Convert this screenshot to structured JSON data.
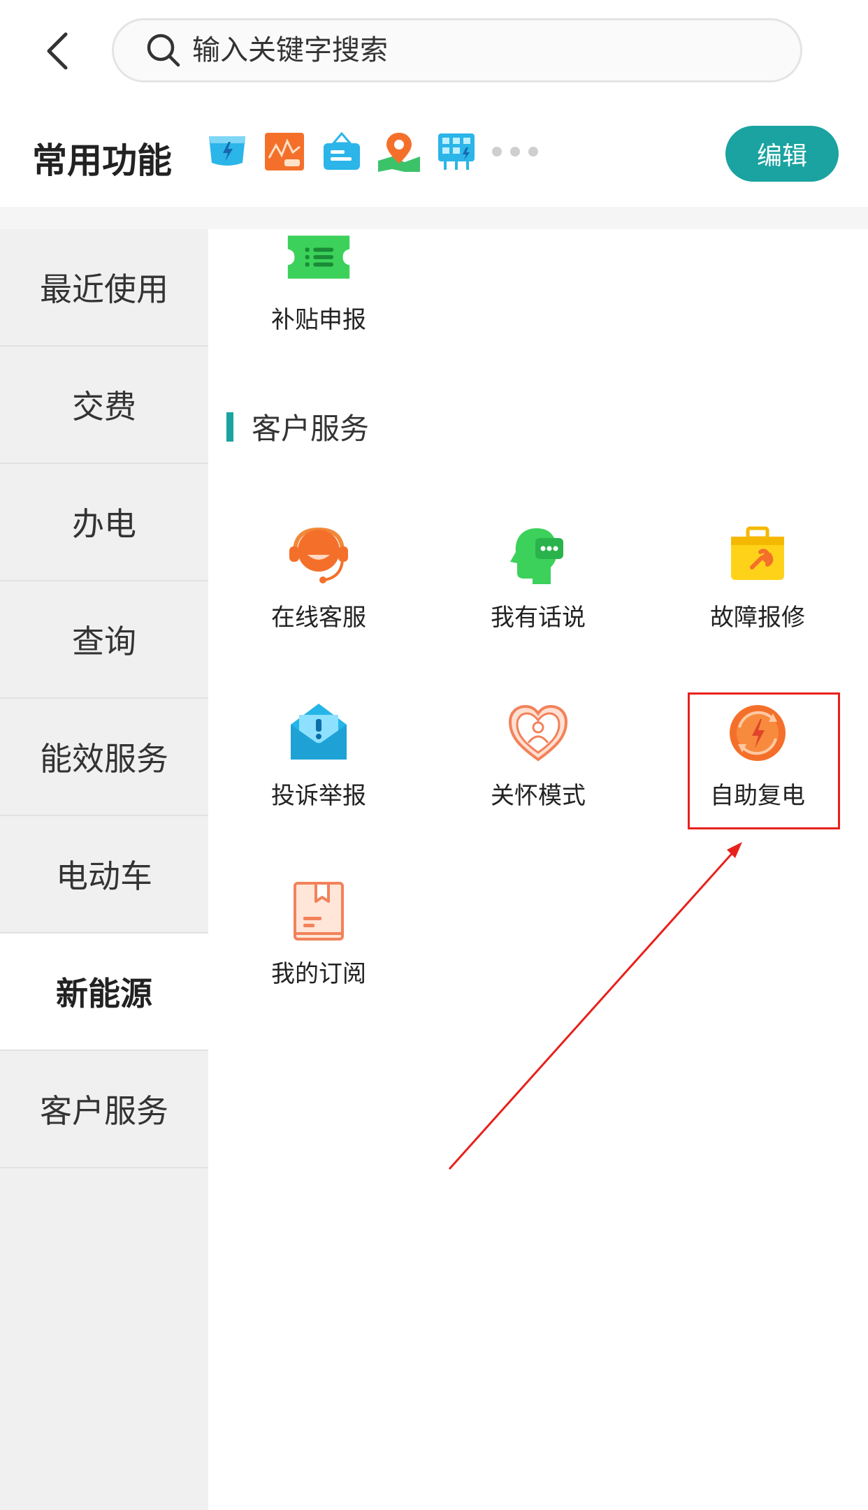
{
  "header": {
    "search": {
      "placeholder": "输入关键字搜索"
    }
  },
  "common": {
    "title": "常用功能",
    "edit_label": "编辑",
    "icons": [
      "pay-electricity-icon",
      "power-chart-icon",
      "sign-icon",
      "map-location-icon",
      "grid-power-icon"
    ]
  },
  "sidebar": {
    "items": [
      {
        "label": "最近使用"
      },
      {
        "label": "交费"
      },
      {
        "label": "办电"
      },
      {
        "label": "查询"
      },
      {
        "label": "能效服务"
      },
      {
        "label": "电动车"
      },
      {
        "label": "新能源",
        "active": true
      },
      {
        "label": "客户服务"
      }
    ]
  },
  "main": {
    "top_tile": {
      "label": "补贴申报",
      "icon": "ticket-icon"
    },
    "section_title": "客户服务",
    "tiles": [
      {
        "label": "在线客服",
        "icon": "online-service-icon"
      },
      {
        "label": "我有话说",
        "icon": "speak-icon"
      },
      {
        "label": "故障报修",
        "icon": "repair-toolbox-icon"
      },
      {
        "label": "投诉举报",
        "icon": "complaint-envelope-icon"
      },
      {
        "label": "关怀模式",
        "icon": "care-heart-icon"
      },
      {
        "label": "自助复电",
        "icon": "self-restore-power-icon"
      },
      {
        "label": "我的订阅",
        "icon": "subscription-book-icon"
      }
    ]
  },
  "colors": {
    "accent": "#1aa3a0",
    "highlight": "#e8211c",
    "sidebar_bg": "#f0f0f0"
  }
}
